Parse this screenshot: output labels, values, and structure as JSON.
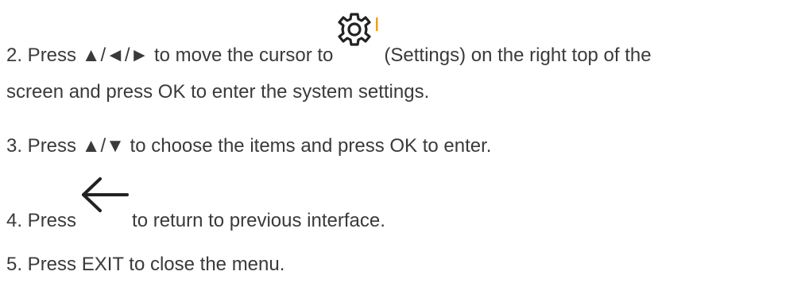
{
  "steps": {
    "step2": {
      "text_a": "2. Press ▲/◄/► to move the cursor to",
      "text_b": "(Settings) on the right top of the",
      "text_c": "screen and press OK to enter the system settings.",
      "icon": "gear-icon"
    },
    "step3": {
      "text": "3. Press ▲/▼ to choose the items and press OK to enter."
    },
    "step4": {
      "text_a": "4. Press",
      "text_b": "to return to previous interface.",
      "icon": "back-arrow-icon"
    },
    "step5": {
      "text": "5. Press EXIT to close the menu."
    }
  },
  "colors": {
    "text": "#3a3a3a",
    "icon": "#222222",
    "gear_accent": "#e8a020"
  }
}
